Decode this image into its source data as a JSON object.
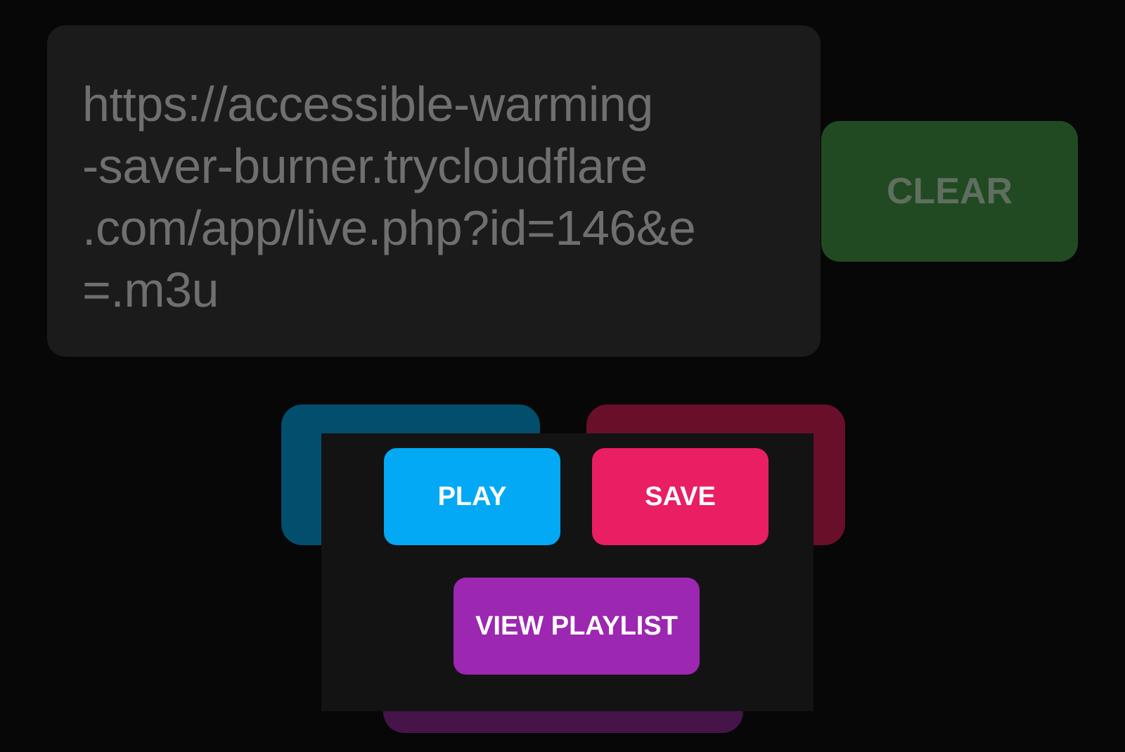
{
  "url_field": {
    "lines": [
      "https://accessible-warming",
      "-saver-burner.trycloudflare",
      ".com/app/live.php?id=146&e",
      "=.m3u"
    ]
  },
  "buttons": {
    "clear_label": "CLEAR"
  },
  "dialog": {
    "play_label": "PLAY",
    "save_label": "SAVE",
    "view_playlist_label": "VIEW PLAYLIST"
  },
  "colors": {
    "background": "#070707",
    "url_box": "#1b1b1b",
    "clear_bg": "#214a22",
    "play": "#03a9f4",
    "save": "#e91e63",
    "view_playlist": "#9c27b0",
    "dialog_bg": "#131313"
  }
}
